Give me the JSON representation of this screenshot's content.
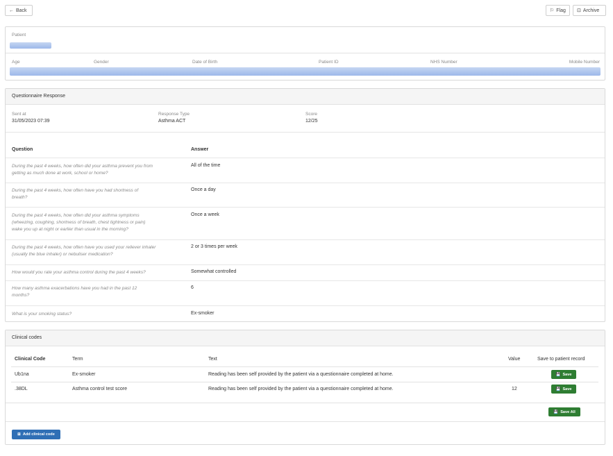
{
  "toolbar": {
    "back_label": "Back",
    "flag_label": "Flag",
    "archive_label": "Archive"
  },
  "patient": {
    "header": "Patient",
    "fields": {
      "age": "Age",
      "gender": "Gender",
      "dob": "Date of Birth",
      "patient_id": "Patient ID",
      "nhs": "NHS Number",
      "mobile": "Mobile Number"
    }
  },
  "questionnaire": {
    "header": "Questionnaire Response",
    "sent_at_label": "Sent at",
    "sent_at_value": "31/05/2023 07:39",
    "response_type_label": "Response Type",
    "response_type_value": "Asthma ACT",
    "score_label": "Score",
    "score_value": "12/25",
    "col_question": "Question",
    "col_answer": "Answer",
    "rows": [
      {
        "q1": "During the past 4 weeks, how often did your asthma prevent you from",
        "q2": "getting as much done at work, school or home?",
        "q3": "",
        "a": "All of the time"
      },
      {
        "q1": "During the past 4 weeks, how often have you had shortness of",
        "q2": "breath?",
        "q3": "",
        "a": "Once a day"
      },
      {
        "q1": "During the past 4 weeks, how often did your asthma symptoms",
        "q2": "(wheezing, coughing, shortness of breath, chest tightness or pain)",
        "q3": "wake you up at night or earlier than usual in the morning?",
        "a": "Once a week"
      },
      {
        "q1": "During the past 4 weeks, how often have you used your reliever inhaler",
        "q2": "(usually the blue inhaler) or nebuliser medication?",
        "q3": "",
        "a": "2 or 3 times per week"
      },
      {
        "q1": "How would you rate your asthma control during the past 4 weeks?",
        "q2": "",
        "q3": "",
        "a": "Somewhat controlled"
      },
      {
        "q1": "How many asthma exacerbations have you had in the past 12",
        "q2": "months?",
        "q3": "",
        "a": "6"
      },
      {
        "q1": "What is your smoking status?",
        "q2": "",
        "q3": "",
        "a": "Ex-smoker"
      }
    ]
  },
  "clinical": {
    "header": "Clinical codes",
    "cols": {
      "code": "Clinical Code",
      "term": "Term",
      "text": "Text",
      "value": "Value",
      "save": "Save to patient record"
    },
    "rows": [
      {
        "code": "Ub1na",
        "term": "Ex-smoker",
        "text": "Reading has been self provided by the patient via a questionnaire completed at home.",
        "value": "",
        "save": "Save"
      },
      {
        "code": ".38DL",
        "term": "Asthma control test score",
        "text": "Reading has been self provided by the patient via a questionnaire completed at home.",
        "value": "12",
        "save": "Save"
      }
    ],
    "save_all": "Save All",
    "add_code": "Add clinical code"
  },
  "colors": {
    "green": "#2e7d32",
    "blue": "#2f6fb5",
    "blur": "#a9c1ec"
  }
}
